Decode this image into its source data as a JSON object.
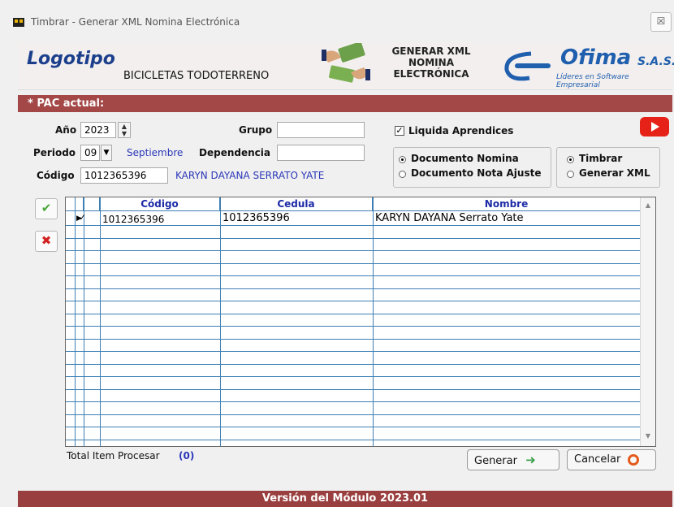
{
  "window": {
    "title": "Timbrar - Generar XML Nomina Electrónica",
    "close_label": "☒"
  },
  "header": {
    "logo_text": "Logotipo",
    "company": "BICICLETAS TODOTERRENO",
    "generate_title_lines": [
      "GENERAR XML",
      "NOMINA",
      "ELECTRÓNICA"
    ],
    "ofima_name": "Ofima",
    "ofima_suffix": "S.A.S.",
    "ofima_tagline": "Líderes en Software Empresarial"
  },
  "pac_label": "* PAC actual:",
  "form": {
    "year_label": "Año",
    "year_value": "2023",
    "period_label": "Periodo",
    "period_value": "09",
    "period_name": "Septiembre",
    "code_label": "Código",
    "code_value": "1012365396",
    "employee_name": "KARYN DAYANA  SERRATO YATE",
    "group_label": "Grupo",
    "group_value": "",
    "dependency_label": "Dependencia",
    "dependency_value": "",
    "liquida_label": "Liquida Aprendices",
    "liquida_checked": true,
    "doc_options": [
      "Documento Nomina",
      "Documento Nota Ajuste"
    ],
    "doc_selected": "Documento Nomina",
    "action_options": [
      "Timbrar",
      "Generar XML"
    ],
    "action_selected": "Timbrar"
  },
  "grid": {
    "headers": [
      "Código",
      "Cedula",
      "Nombre"
    ],
    "rows": [
      {
        "checked": true,
        "codigo": "1012365396",
        "cedula": "1012365396",
        "nombre": "KARYN DAYANA  Serrato Yate"
      }
    ]
  },
  "footer": {
    "total_label": "Total  Item Procesar",
    "total_value": "(0)"
  },
  "buttons": {
    "generate": "Generar",
    "cancel": "Cancelar"
  },
  "version": "Versión del Módulo 2023.01",
  "colors": {
    "accent_bar": "#a34747",
    "grid_line": "#3e7fb4",
    "link_blue": "#2a37b8"
  }
}
